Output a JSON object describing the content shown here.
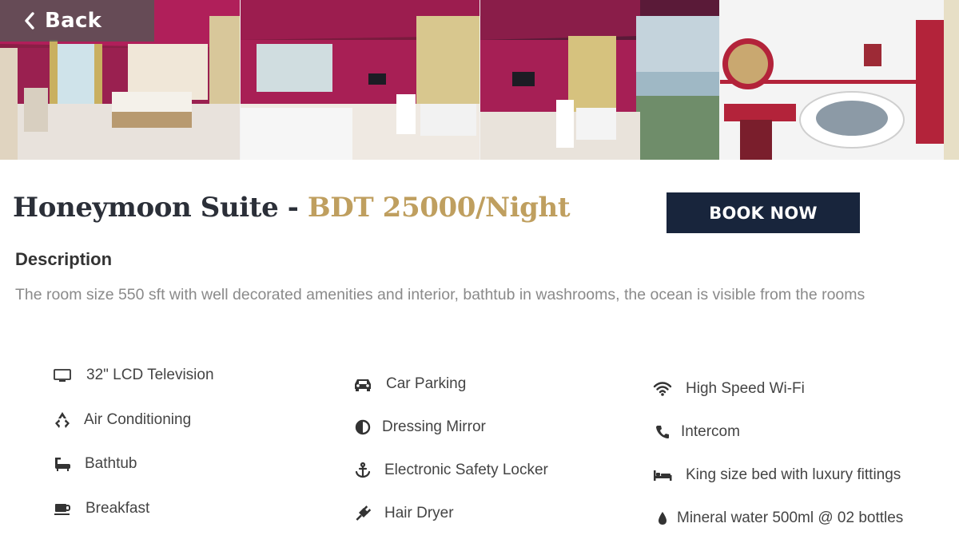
{
  "nav": {
    "back_label": "Back"
  },
  "gallery": [
    {
      "name": "bedroom-photo"
    },
    {
      "name": "living-area-photo"
    },
    {
      "name": "balcony-view-photo"
    },
    {
      "name": "bathroom-photo"
    }
  ],
  "room": {
    "name": "Honeymoon Suite",
    "separator": "-",
    "price": "BDT 25000/Night",
    "book_label": "BOOK NOW",
    "description_heading": "Description",
    "description": "The room size 550 sft with well decorated amenities and interior, bathtub in washrooms, the ocean is visible from the rooms"
  },
  "amenities": [
    {
      "label": "32\" LCD Television",
      "icon": "tv-icon"
    },
    {
      "label": "Air Conditioning",
      "icon": "recycle-icon"
    },
    {
      "label": "Bathtub",
      "icon": "bathtub-icon"
    },
    {
      "label": "Breakfast",
      "icon": "coffee-cup-icon"
    },
    {
      "label": "Car Parking",
      "icon": "car-icon"
    },
    {
      "label": "Dressing Mirror",
      "icon": "half-circle-icon"
    },
    {
      "label": "Electronic Safety Locker",
      "icon": "anchor-icon"
    },
    {
      "label": "Hair Dryer",
      "icon": "plug-icon"
    },
    {
      "label": "High Speed Wi-Fi",
      "icon": "wifi-icon"
    },
    {
      "label": "Intercom",
      "icon": "phone-icon"
    },
    {
      "label": "King size bed with luxury fittings",
      "icon": "bed-icon"
    },
    {
      "label": "Mineral water 500ml @ 02 bottles",
      "icon": "water-drop-icon"
    }
  ],
  "colors": {
    "price_gold": "#bf9f5f",
    "button_navy": "#18253c",
    "heading_dark": "#2b2f38"
  }
}
